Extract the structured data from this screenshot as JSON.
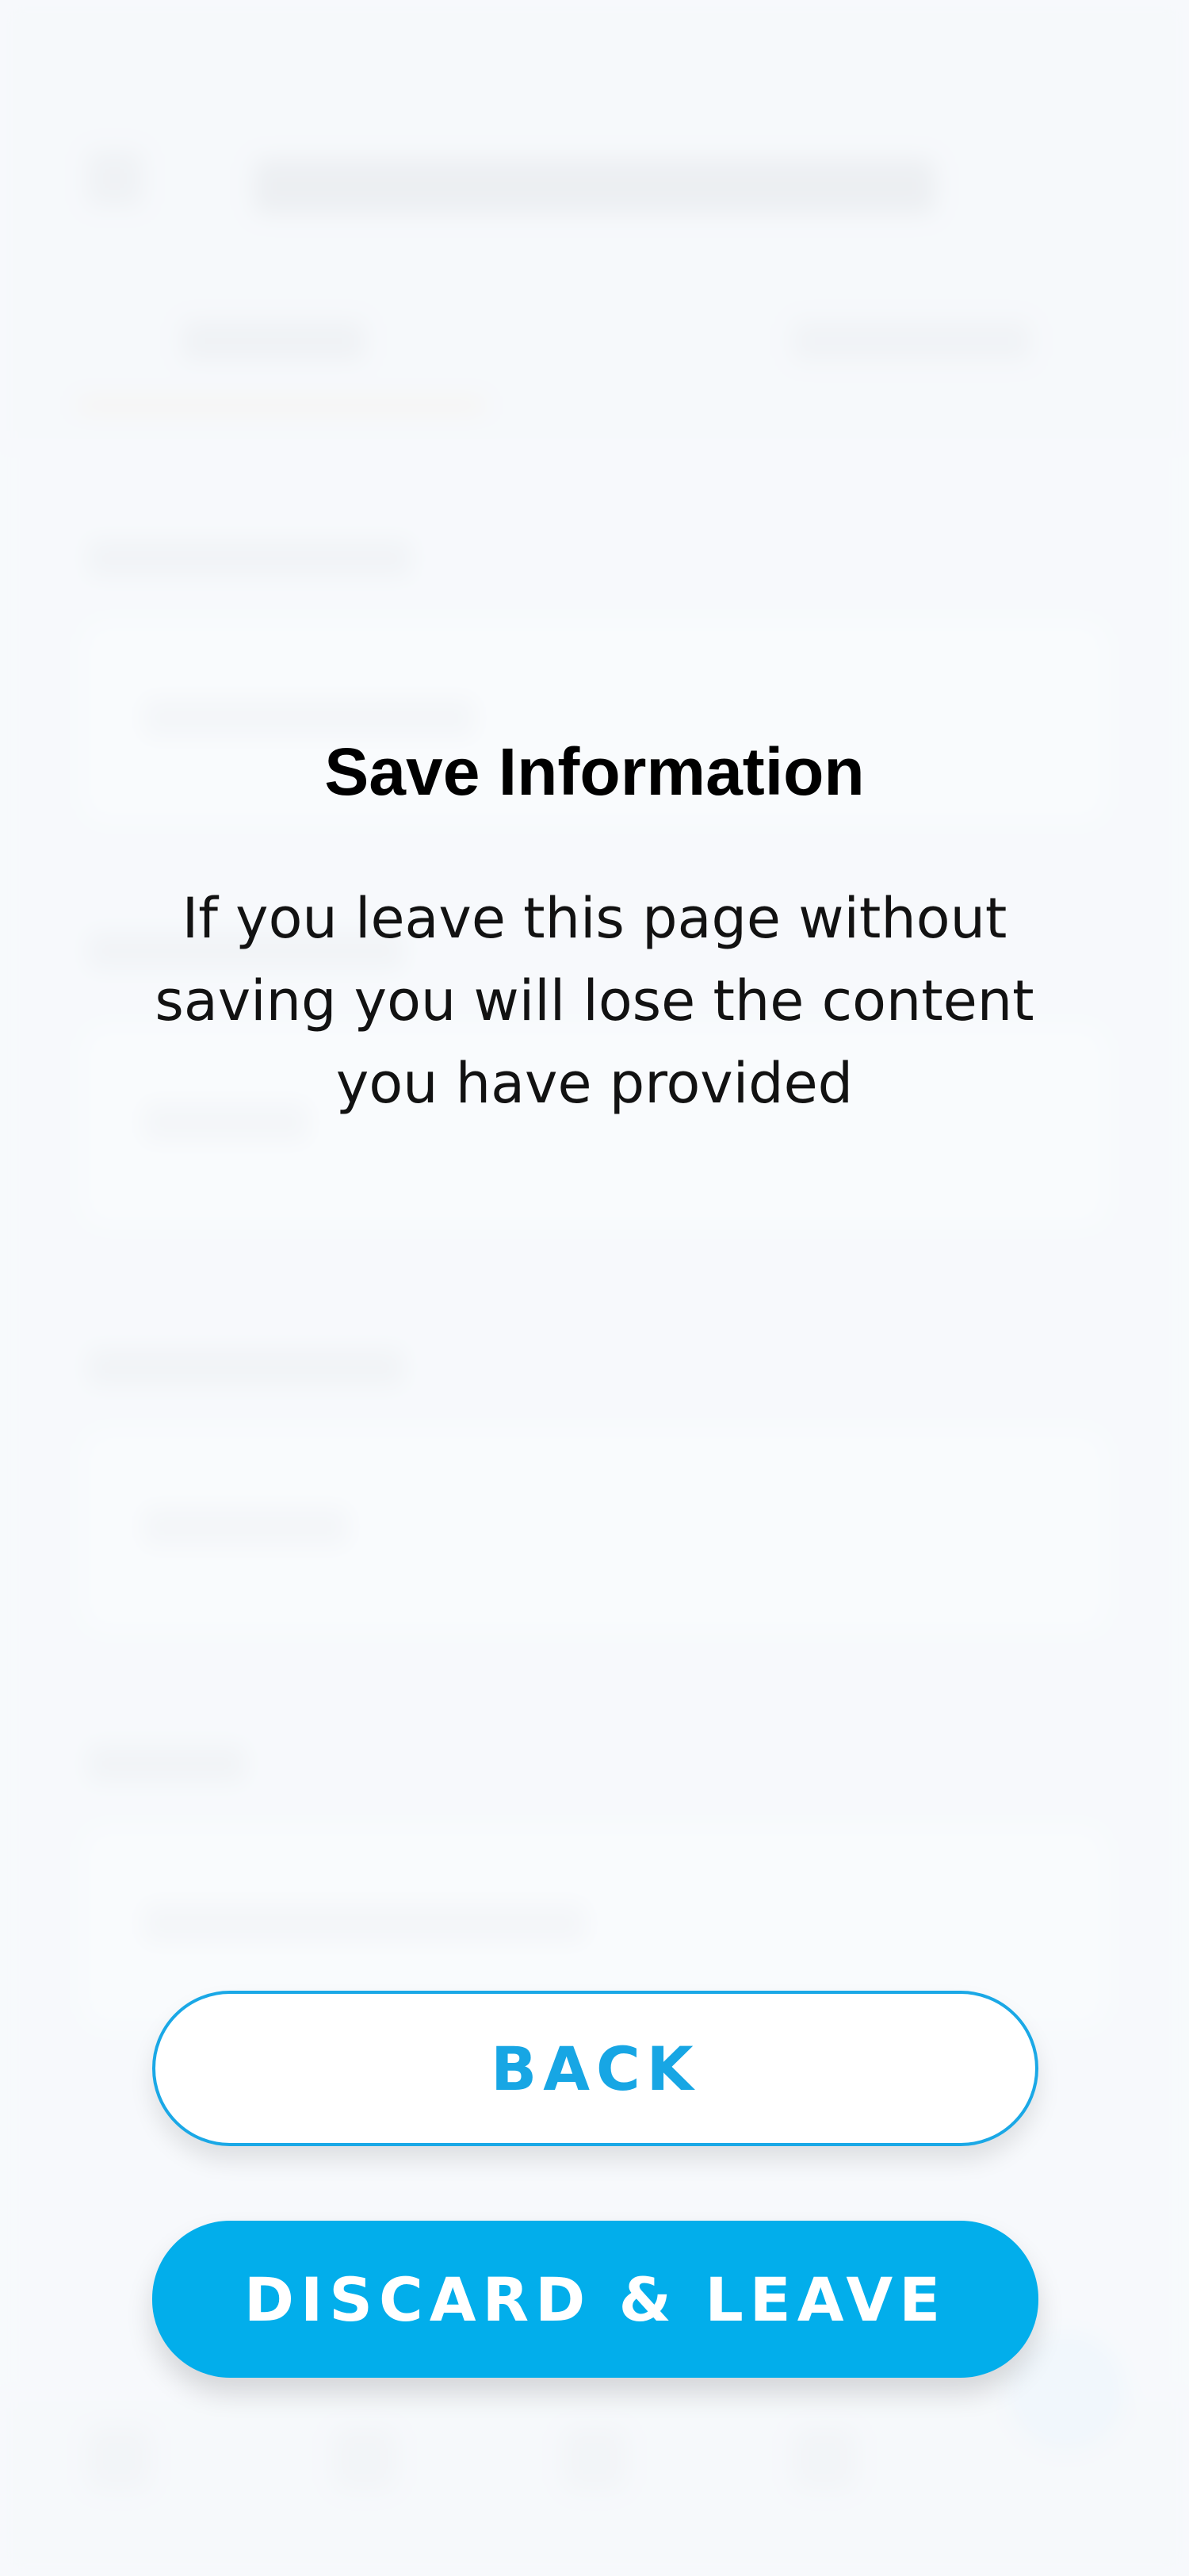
{
  "dialog": {
    "title": "Save Information",
    "message": "If you leave this page without saving you will lose the content you have provided",
    "back_label": "BACK",
    "discard_label": "DISCARD & LEAVE"
  },
  "colors": {
    "accent": "#02AEEB",
    "back_button_text": "#17A6E4",
    "title_text": "#000000"
  }
}
